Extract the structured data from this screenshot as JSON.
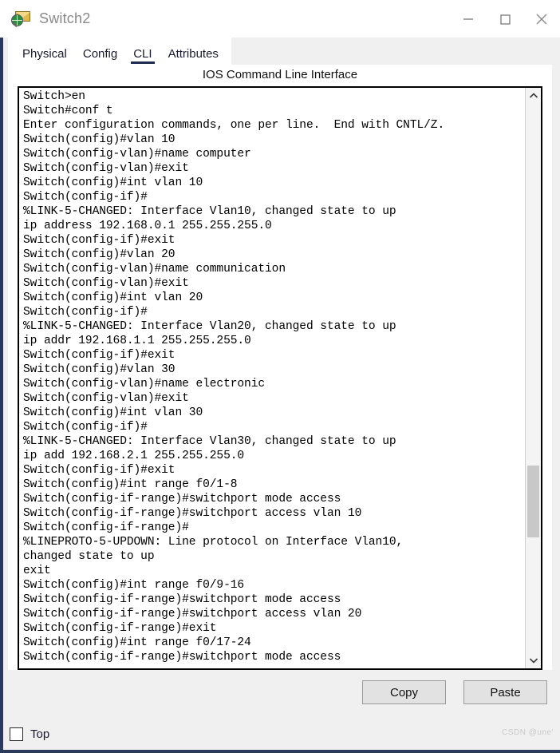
{
  "window": {
    "title": "Switch2",
    "icon": "switch-device-icon",
    "controls": {
      "minimize": "minimize-icon",
      "maximize": "maximize-icon",
      "close": "close-icon"
    }
  },
  "tabs": [
    {
      "label": "Physical",
      "active": false
    },
    {
      "label": "Config",
      "active": false
    },
    {
      "label": "CLI",
      "active": true
    },
    {
      "label": "Attributes",
      "active": false
    }
  ],
  "cli": {
    "header": "IOS Command Line Interface",
    "lines": [
      "Switch>en",
      "Switch#conf t",
      "Enter configuration commands, one per line.  End with CNTL/Z.",
      "Switch(config)#vlan 10",
      "Switch(config-vlan)#name computer",
      "Switch(config-vlan)#exit",
      "Switch(config)#int vlan 10",
      "Switch(config-if)#",
      "%LINK-5-CHANGED: Interface Vlan10, changed state to up",
      "ip address 192.168.0.1 255.255.255.0",
      "Switch(config-if)#exit",
      "Switch(config)#vlan 20",
      "Switch(config-vlan)#name communication",
      "Switch(config-vlan)#exit",
      "Switch(config)#int vlan 20",
      "Switch(config-if)#",
      "%LINK-5-CHANGED: Interface Vlan20, changed state to up",
      "ip addr 192.168.1.1 255.255.255.0",
      "Switch(config-if)#exit",
      "Switch(config)#vlan 30",
      "Switch(config-vlan)#name electronic",
      "Switch(config-vlan)#exit",
      "Switch(config)#int vlan 30",
      "Switch(config-if)#",
      "%LINK-5-CHANGED: Interface Vlan30, changed state to up",
      "ip add 192.168.2.1 255.255.255.0",
      "Switch(config-if)#exit",
      "Switch(config)#int range f0/1-8",
      "Switch(config-if-range)#switchport mode access",
      "Switch(config-if-range)#switchport access vlan 10",
      "Switch(config-if-range)#",
      "%LINEPROTO-5-UPDOWN: Line protocol on Interface Vlan10,",
      "changed state to up",
      "exit",
      "Switch(config)#int range f0/9-16",
      "Switch(config-if-range)#switchport mode access",
      "Switch(config-if-range)#switchport access vlan 20",
      "Switch(config-if-range)#exit",
      "Switch(config)#int range f0/17-24",
      "Switch(config-if-range)#switchport mode access"
    ],
    "scrollbar": {
      "up_arrow": "chevron-up-icon",
      "down_arrow": "chevron-down-icon"
    }
  },
  "buttons": {
    "copy": "Copy",
    "paste": "Paste"
  },
  "bottom": {
    "top_checkbox_label": "Top",
    "top_checkbox_checked": false,
    "watermark": "CSDN @une'"
  }
}
